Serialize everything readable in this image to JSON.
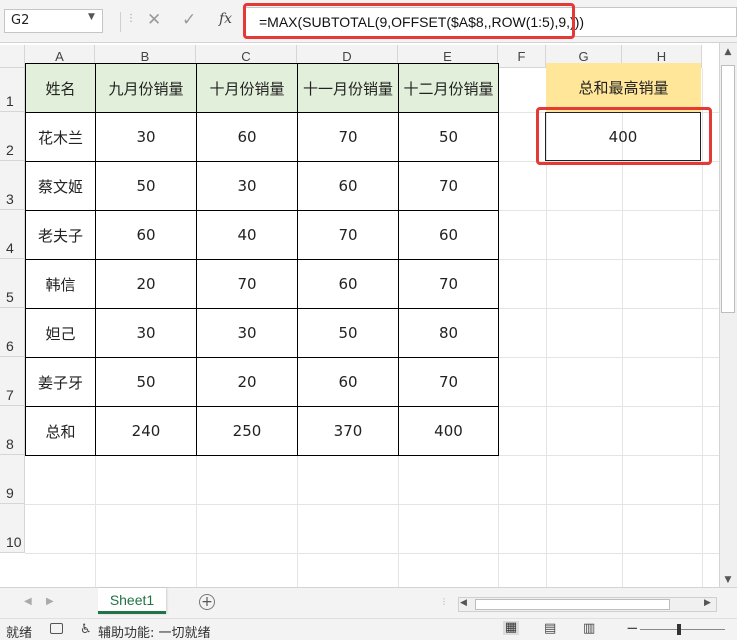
{
  "formula_bar": {
    "name_box": "G2",
    "cancel_icon": "✕",
    "enter_icon": "✓",
    "fx_label": "fx",
    "formula": "=MAX(SUBTOTAL(9,OFFSET($A$8,,ROW(1:5),9,)))"
  },
  "columns": [
    "A",
    "B",
    "C",
    "D",
    "E",
    "F",
    "G",
    "H"
  ],
  "rows": [
    "1",
    "2",
    "3",
    "4",
    "5",
    "6",
    "7",
    "8",
    "9",
    "10"
  ],
  "table": {
    "headers": [
      "姓名",
      "九月份销量",
      "十月份销量",
      "十一月份销量",
      "十二月份销量"
    ],
    "rows": [
      [
        "花木兰",
        "30",
        "60",
        "70",
        "50"
      ],
      [
        "蔡文姬",
        "50",
        "30",
        "60",
        "70"
      ],
      [
        "老夫子",
        "60",
        "40",
        "70",
        "60"
      ],
      [
        "韩信",
        "20",
        "70",
        "60",
        "70"
      ],
      [
        "妲己",
        "30",
        "30",
        "50",
        "80"
      ],
      [
        "姜子牙",
        "50",
        "20",
        "60",
        "70"
      ],
      [
        "总和",
        "240",
        "250",
        "370",
        "400"
      ]
    ]
  },
  "summary": {
    "label": "总和最高销量",
    "value": "400"
  },
  "sheet_tabs": {
    "active": "Sheet1",
    "add_icon": "+"
  },
  "status_bar": {
    "ready": "就绪",
    "accessibility": "辅助功能: 一切就绪"
  },
  "colors": {
    "header_fill": "#e2efda",
    "summary_fill": "#ffe699",
    "highlight": "#e53935",
    "accent": "#217346"
  }
}
